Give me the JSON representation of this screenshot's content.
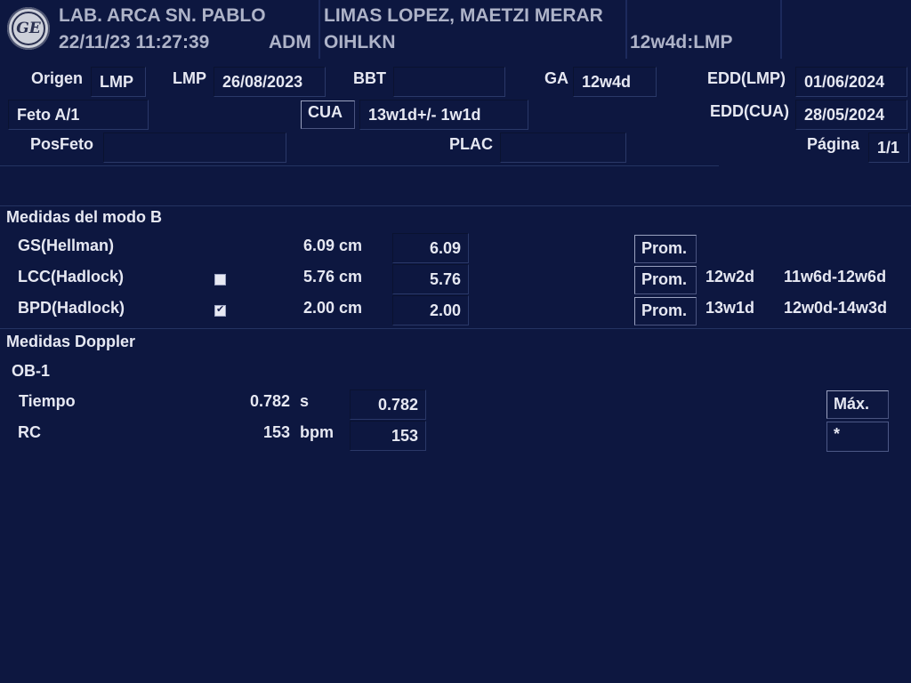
{
  "header": {
    "institution": "LAB. ARCA SN. PABLO",
    "datetime": "22/11/23 11:27:39",
    "operator": "ADM",
    "patient_name": "LIMAS LOPEZ, MAETZI MERAR",
    "patient_id": "OIHLKN",
    "ga_summary": "12w4d:LMP"
  },
  "info": {
    "origen_label": "Origen",
    "origen_value": "LMP",
    "lmp_label": "LMP",
    "lmp_value": "26/08/2023",
    "bbt_label": "BBT",
    "bbt_value": "",
    "ga_label": "GA",
    "ga_value": "12w4d",
    "edd_lmp_label": "EDD(LMP)",
    "edd_lmp_value": "01/06/2024",
    "feto_value": "Feto A/1",
    "cua_label": "CUA",
    "cua_value": "13w1d+/- 1w1d",
    "edd_cua_label": "EDD(CUA)",
    "edd_cua_value": "28/05/2024",
    "posfeto_label": "PosFeto",
    "posfeto_value": "",
    "plac_label": "PLAC",
    "plac_value": "",
    "pagina_label": "Página",
    "pagina_value": "1/1"
  },
  "bmode": {
    "title": "Medidas del modo B",
    "rows": [
      {
        "name": "GS(Hellman)",
        "value": "6.09 cm",
        "field": "6.09",
        "btn": "Prom.",
        "ga": "",
        "range": "",
        "checkbox": "none"
      },
      {
        "name": "LCC(Hadlock)",
        "value": "5.76 cm",
        "field": "5.76",
        "btn": "Prom.",
        "ga": "12w2d",
        "range": "11w6d-12w6d",
        "checkbox": "unchecked"
      },
      {
        "name": "BPD(Hadlock)",
        "value": "2.00 cm",
        "field": "2.00",
        "btn": "Prom.",
        "ga": "13w1d",
        "range": "12w0d-14w3d",
        "checkbox": "checked"
      }
    ]
  },
  "doppler": {
    "title": "Medidas Doppler",
    "subtitle": "OB-1",
    "rows": [
      {
        "name": "Tiempo",
        "value": "0.782",
        "unit": "s",
        "field": "0.782"
      },
      {
        "name": "RC",
        "value": "153",
        "unit": "bpm",
        "field": "153"
      }
    ],
    "max_label": "Máx.",
    "max_value": "*"
  },
  "icons": {
    "logo": "ge-logo-icon"
  },
  "colors": {
    "background": "#0d1740",
    "text": "#e6e8f2",
    "header_text": "#aeb3c8"
  }
}
